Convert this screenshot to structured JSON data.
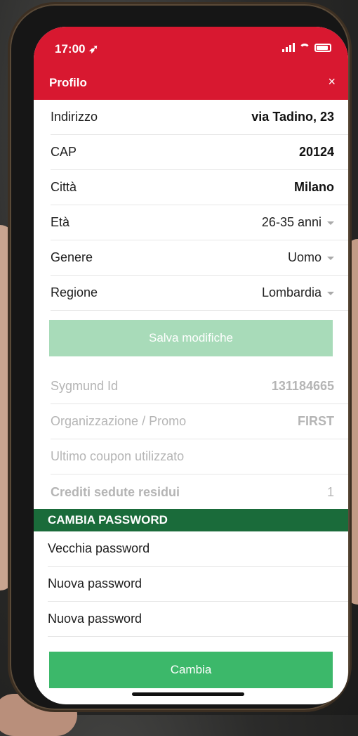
{
  "status": {
    "time": "17:00"
  },
  "header": {
    "title": "Profilo",
    "close": "×"
  },
  "fields": [
    {
      "label": "Indirizzo",
      "value": "via Tadino, 23"
    },
    {
      "label": "CAP",
      "value": "20124"
    },
    {
      "label": "Città",
      "value": "Milano"
    },
    {
      "label": "Età",
      "value": "26-35 anni"
    },
    {
      "label": "Genere",
      "value": "Uomo"
    },
    {
      "label": "Regione",
      "value": "Lombardia"
    }
  ],
  "save_button": "Salva modifiche",
  "info": [
    {
      "label": "Sygmund Id",
      "value": "131184665"
    },
    {
      "label": "Organizzazione / Promo",
      "value": "FIRST"
    },
    {
      "label": "Ultimo coupon utilizzato",
      "value": ""
    },
    {
      "label": "Crediti sedute residui",
      "value": "1"
    }
  ],
  "password_section": {
    "title": "CAMBIA PASSWORD",
    "fields": [
      "Vecchia password",
      "Nuova password",
      "Nuova password"
    ],
    "button": "Cambia"
  },
  "colors": {
    "header": "#d81830",
    "section": "#1a6b3a",
    "save": "#a8dbb9",
    "change": "#3cb86a"
  }
}
